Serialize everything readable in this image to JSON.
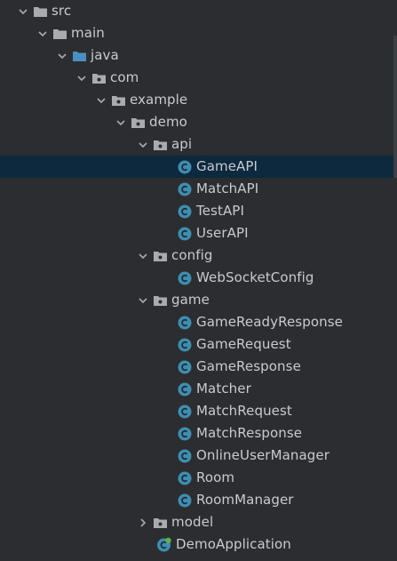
{
  "colors": {
    "background": "#2b2d30",
    "selection": "#0d293e",
    "text": "#c8cbd0",
    "folder": "#a9abaf",
    "source_folder": "#4a8fc4",
    "class_icon": "#3f8eb0"
  },
  "tree": [
    {
      "label": "src",
      "icon": "folder-icon",
      "expanded": true
    },
    {
      "label": "main",
      "icon": "folder-icon",
      "expanded": true
    },
    {
      "label": "java",
      "icon": "source-folder-icon",
      "expanded": true
    },
    {
      "label": "com",
      "icon": "package-icon",
      "expanded": true
    },
    {
      "label": "example",
      "icon": "package-icon",
      "expanded": true
    },
    {
      "label": "demo",
      "icon": "package-icon",
      "expanded": true
    },
    {
      "label": "api",
      "icon": "package-icon",
      "expanded": true
    },
    {
      "label": "GameAPI",
      "icon": "class-icon",
      "selected": true
    },
    {
      "label": "MatchAPI",
      "icon": "class-icon"
    },
    {
      "label": "TestAPI",
      "icon": "class-icon"
    },
    {
      "label": "UserAPI",
      "icon": "class-icon"
    },
    {
      "label": "config",
      "icon": "package-icon",
      "expanded": true
    },
    {
      "label": "WebSocketConfig",
      "icon": "class-icon"
    },
    {
      "label": "game",
      "icon": "package-icon",
      "expanded": true
    },
    {
      "label": "GameReadyResponse",
      "icon": "class-icon"
    },
    {
      "label": "GameRequest",
      "icon": "class-icon"
    },
    {
      "label": "GameResponse",
      "icon": "class-icon"
    },
    {
      "label": "Matcher",
      "icon": "class-icon"
    },
    {
      "label": "MatchRequest",
      "icon": "class-icon"
    },
    {
      "label": "MatchResponse",
      "icon": "class-icon"
    },
    {
      "label": "OnlineUserManager",
      "icon": "class-icon"
    },
    {
      "label": "Room",
      "icon": "class-icon"
    },
    {
      "label": "RoomManager",
      "icon": "class-icon"
    },
    {
      "label": "model",
      "icon": "package-icon",
      "expanded": false
    },
    {
      "label": "DemoApplication",
      "icon": "spring-boot-class-icon"
    }
  ]
}
